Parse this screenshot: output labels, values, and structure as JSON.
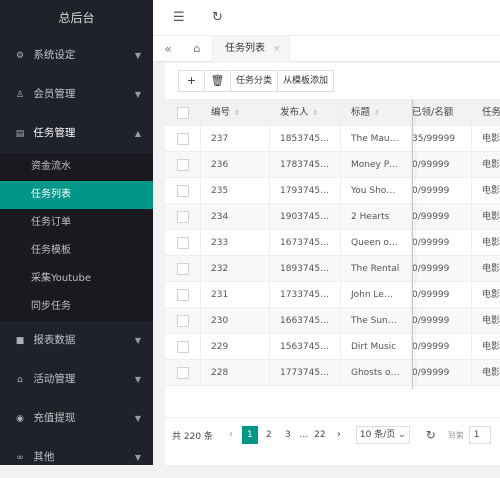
{
  "sidebar": {
    "logo": "总后台",
    "groups": [
      {
        "label": "系统设定",
        "icon": "gear-icon",
        "glyph": "⚙"
      },
      {
        "label": "会员管理",
        "icon": "user-icon",
        "glyph": "♙"
      },
      {
        "label": "任务管理",
        "icon": "document-icon",
        "glyph": "▤"
      },
      {
        "label": "报表数据",
        "icon": "chat-icon",
        "glyph": "■"
      },
      {
        "label": "活动管理",
        "icon": "bank-icon",
        "glyph": "⌂"
      },
      {
        "label": "充值提现",
        "icon": "coin-icon",
        "glyph": "◉"
      },
      {
        "label": "其他",
        "icon": "link-icon",
        "glyph": "∞"
      }
    ],
    "task_submenu": [
      "资金流水",
      "任务列表",
      "任务订单",
      "任务模板",
      "采集Youtube",
      "同步任务"
    ],
    "active_sub": "任务列表",
    "accent": "#009688"
  },
  "topbar": {
    "menu_toggle_icon": "indent-icon",
    "refresh_icon": "refresh-icon"
  },
  "tabs": {
    "prev_icon": "double-left-icon",
    "home_icon": "home-icon",
    "current": "任务列表",
    "close_glyph": "×"
  },
  "toolbar": {
    "add": "+",
    "delete_icon": "trash-icon",
    "category": "任务分类",
    "from_template": "从模板添加"
  },
  "table": {
    "columns": [
      "编号",
      "发布人",
      "标题",
      "已领/名额",
      "任务"
    ],
    "rows": [
      {
        "id": "237",
        "publisher": "1853745…",
        "title": "The Mau…",
        "quota": "35/99999",
        "type": "电影"
      },
      {
        "id": "236",
        "publisher": "1783745…",
        "title": "Money P…",
        "quota": "0/99999",
        "type": "电影"
      },
      {
        "id": "235",
        "publisher": "1793745…",
        "title": "You Sho…",
        "quota": "0/99999",
        "type": "电影"
      },
      {
        "id": "234",
        "publisher": "1903745…",
        "title": "2 Hearts",
        "quota": "0/99999",
        "type": "电影"
      },
      {
        "id": "233",
        "publisher": "1673745…",
        "title": "Queen o…",
        "quota": "0/99999",
        "type": "电影"
      },
      {
        "id": "232",
        "publisher": "1893745…",
        "title": "The Rental",
        "quota": "0/99999",
        "type": "电影"
      },
      {
        "id": "231",
        "publisher": "1733745…",
        "title": "John Le…",
        "quota": "0/99999",
        "type": "电影"
      },
      {
        "id": "230",
        "publisher": "1663745…",
        "title": "The Sun…",
        "quota": "0/99999",
        "type": "电影"
      },
      {
        "id": "229",
        "publisher": "1563745…",
        "title": "Dirt Music",
        "quota": "0/99999",
        "type": "电影"
      },
      {
        "id": "228",
        "publisher": "1773745…",
        "title": "Ghosts o…",
        "quota": "0/99999",
        "type": "电影"
      }
    ]
  },
  "pager": {
    "total": "共 220 条",
    "pages": [
      "1",
      "2",
      "3",
      "…",
      "22"
    ],
    "current": "1",
    "page_size": "10 条/页",
    "goto_label": "到第",
    "goto_value": "1"
  }
}
